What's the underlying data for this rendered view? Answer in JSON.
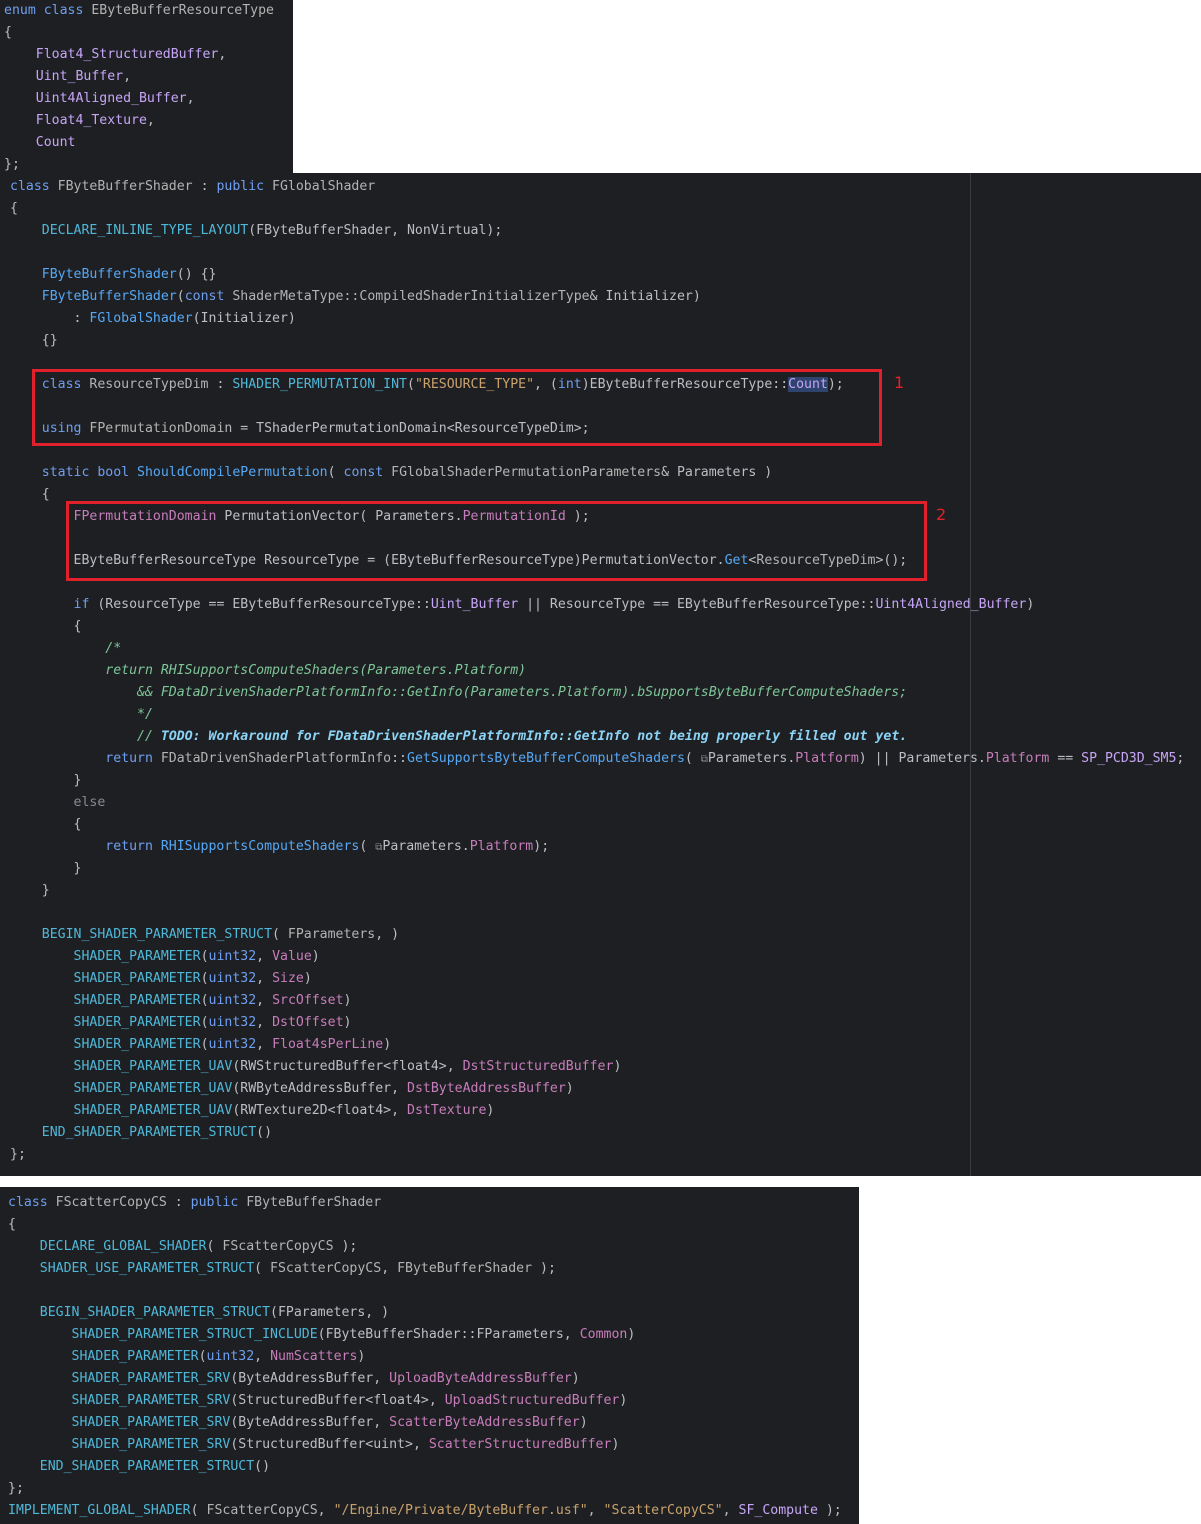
{
  "enum_panel": {
    "lines": [
      [
        [
          "kw",
          "enum class "
        ],
        [
          "type",
          "EByteBufferResourceType"
        ]
      ],
      [
        [
          "plain",
          "{"
        ]
      ],
      [
        [
          "plain",
          "    "
        ],
        [
          "enum",
          "Float4_StructuredBuffer"
        ],
        [
          "plain",
          ","
        ]
      ],
      [
        [
          "plain",
          "    "
        ],
        [
          "enum",
          "Uint_Buffer"
        ],
        [
          "plain",
          ","
        ]
      ],
      [
        [
          "plain",
          "    "
        ],
        [
          "enum",
          "Uint4Aligned_Buffer"
        ],
        [
          "plain",
          ","
        ]
      ],
      [
        [
          "plain",
          "    "
        ],
        [
          "enum",
          "Float4_Texture"
        ],
        [
          "plain",
          ","
        ]
      ],
      [
        [
          "plain",
          "    "
        ],
        [
          "enum",
          "Count"
        ]
      ],
      [
        [
          "plain",
          "};"
        ]
      ]
    ]
  },
  "class_panel": {
    "lines": [
      [
        [
          "kw",
          "class "
        ],
        [
          "type",
          "FByteBufferShader"
        ],
        [
          "plain",
          " : "
        ],
        [
          "kw",
          "public "
        ],
        [
          "type",
          "FGlobalShader"
        ]
      ],
      [
        [
          "plain",
          "{"
        ]
      ],
      [
        [
          "plain",
          "    "
        ],
        [
          "macro",
          "DECLARE_INLINE_TYPE_LAYOUT"
        ],
        [
          "plain",
          "(FByteBufferShader, NonVirtual);"
        ]
      ],
      [
        [
          "plain",
          ""
        ]
      ],
      [
        [
          "plain",
          "    "
        ],
        [
          "fn",
          "FByteBufferShader"
        ],
        [
          "plain",
          "() {}"
        ]
      ],
      [
        [
          "plain",
          "    "
        ],
        [
          "fn",
          "FByteBufferShader"
        ],
        [
          "plain",
          "("
        ],
        [
          "kw",
          "const "
        ],
        [
          "type",
          "ShaderMetaType::CompiledShaderInitializerType"
        ],
        [
          "plain",
          "& Initializer)"
        ]
      ],
      [
        [
          "plain",
          "        : "
        ],
        [
          "fn",
          "FGlobalShader"
        ],
        [
          "plain",
          "(Initializer)"
        ]
      ],
      [
        [
          "plain",
          "    {}"
        ]
      ],
      [
        [
          "plain",
          ""
        ]
      ],
      [
        [
          "plain",
          "    "
        ],
        [
          "kw",
          "class "
        ],
        [
          "type",
          "ResourceTypeDim"
        ],
        [
          "plain",
          " : "
        ],
        [
          "macro",
          "SHADER_PERMUTATION_INT"
        ],
        [
          "plain",
          "("
        ],
        [
          "str",
          "\"RESOURCE_TYPE\""
        ],
        [
          "plain",
          ", ("
        ],
        [
          "kw",
          "int"
        ],
        [
          "plain",
          ")EByteBufferResourceType::"
        ],
        [
          "sel",
          "Count"
        ],
        [
          "plain",
          ");"
        ]
      ],
      [
        [
          "plain",
          ""
        ]
      ],
      [
        [
          "plain",
          "    "
        ],
        [
          "kw",
          "using "
        ],
        [
          "type",
          "FPermutationDomain"
        ],
        [
          "plain",
          " = TShaderPermutationDomain<ResourceTypeDim>;"
        ]
      ],
      [
        [
          "plain",
          ""
        ]
      ],
      [
        [
          "plain",
          "    "
        ],
        [
          "kw",
          "static bool "
        ],
        [
          "fn",
          "ShouldCompilePermutation"
        ],
        [
          "plain",
          "( "
        ],
        [
          "kw",
          "const "
        ],
        [
          "type",
          "FGlobalShaderPermutationParameters"
        ],
        [
          "plain",
          "& Parameters )"
        ]
      ],
      [
        [
          "plain",
          "    {"
        ]
      ],
      [
        [
          "plain",
          "        "
        ],
        [
          "param",
          "FPermutationDomain"
        ],
        [
          "plain",
          " PermutationVector( Parameters."
        ],
        [
          "field",
          "PermutationId"
        ],
        [
          "plain",
          " );"
        ]
      ],
      [
        [
          "plain",
          ""
        ]
      ],
      [
        [
          "plain",
          "        EByteBufferResourceType "
        ],
        [
          "plain",
          "ResourceType"
        ],
        [
          "plain",
          " = (EByteBufferResourceType)PermutationVector."
        ],
        [
          "fn",
          "Get"
        ],
        [
          "plain",
          "<"
        ],
        [
          "type",
          "ResourceTypeDim"
        ],
        [
          "plain",
          ">();"
        ]
      ],
      [
        [
          "plain",
          ""
        ]
      ],
      [
        [
          "plain",
          "        "
        ],
        [
          "kw",
          "if "
        ],
        [
          "plain",
          "(ResourceType == EByteBufferResourceType::"
        ],
        [
          "enum",
          "Uint_Buffer"
        ],
        [
          "plain",
          " || ResourceType == EByteBufferResourceType::"
        ],
        [
          "enum",
          "Uint4Aligned_Buffer"
        ],
        [
          "plain",
          ")"
        ]
      ],
      [
        [
          "plain",
          "        {"
        ]
      ],
      [
        [
          "plain",
          "            "
        ],
        [
          "cm",
          "/*"
        ]
      ],
      [
        [
          "plain",
          "            "
        ],
        [
          "cm",
          "return RHISupportsComputeShaders(Parameters.Platform)"
        ]
      ],
      [
        [
          "plain",
          "                "
        ],
        [
          "cm",
          "&& FDataDrivenShaderPlatformInfo::GetInfo(Parameters.Platform).bSupportsByteBufferComputeShaders;"
        ]
      ],
      [
        [
          "plain",
          "                "
        ],
        [
          "cm",
          "*/"
        ]
      ],
      [
        [
          "plain",
          "                "
        ],
        [
          "cm",
          "// "
        ],
        [
          "todo",
          "TODO: Workaround for FDataDrivenShaderPlatformInfo::GetInfo not being properly filled out yet."
        ]
      ],
      [
        [
          "plain",
          "            "
        ],
        [
          "kw",
          "return "
        ],
        [
          "type",
          "FDataDrivenShaderPlatformInfo"
        ],
        [
          "plain",
          "::"
        ],
        [
          "fn",
          "GetSupportsByteBufferComputeShaders"
        ],
        [
          "plain",
          "( "
        ],
        [
          "hint",
          "⧉"
        ],
        [
          "plain",
          "Parameters."
        ],
        [
          "field",
          "Platform"
        ],
        [
          "plain",
          ") || Parameters."
        ],
        [
          "field",
          "Platform"
        ],
        [
          "plain",
          " == "
        ],
        [
          "enum",
          "SP_PCD3D_SM5"
        ],
        [
          "plain",
          ";"
        ]
      ],
      [
        [
          "plain",
          "        }"
        ]
      ],
      [
        [
          "plain",
          "        "
        ],
        [
          "else",
          "else"
        ]
      ],
      [
        [
          "plain",
          "        {"
        ]
      ],
      [
        [
          "plain",
          "            "
        ],
        [
          "kw",
          "return "
        ],
        [
          "fn",
          "RHISupportsComputeShaders"
        ],
        [
          "plain",
          "( "
        ],
        [
          "hint",
          "⧉"
        ],
        [
          "plain",
          "Parameters."
        ],
        [
          "field",
          "Platform"
        ],
        [
          "plain",
          ");"
        ]
      ],
      [
        [
          "plain",
          "        }"
        ]
      ],
      [
        [
          "plain",
          "    }"
        ]
      ],
      [
        [
          "plain",
          ""
        ]
      ],
      [
        [
          "plain",
          "    "
        ],
        [
          "macro",
          "BEGIN_SHADER_PARAMETER_STRUCT"
        ],
        [
          "plain",
          "( "
        ],
        [
          "type",
          "FParameters"
        ],
        [
          "plain",
          ", )"
        ]
      ],
      [
        [
          "plain",
          "        "
        ],
        [
          "macro",
          "SHADER_PARAMETER"
        ],
        [
          "plain",
          "("
        ],
        [
          "kw",
          "uint32"
        ],
        [
          "plain",
          ", "
        ],
        [
          "field",
          "Value"
        ],
        [
          "plain",
          ")"
        ]
      ],
      [
        [
          "plain",
          "        "
        ],
        [
          "macro",
          "SHADER_PARAMETER"
        ],
        [
          "plain",
          "("
        ],
        [
          "kw",
          "uint32"
        ],
        [
          "plain",
          ", "
        ],
        [
          "field",
          "Size"
        ],
        [
          "plain",
          ")"
        ]
      ],
      [
        [
          "plain",
          "        "
        ],
        [
          "macro",
          "SHADER_PARAMETER"
        ],
        [
          "plain",
          "("
        ],
        [
          "kw",
          "uint32"
        ],
        [
          "plain",
          ", "
        ],
        [
          "field",
          "SrcOffset"
        ],
        [
          "plain",
          ")"
        ]
      ],
      [
        [
          "plain",
          "        "
        ],
        [
          "macro",
          "SHADER_PARAMETER"
        ],
        [
          "plain",
          "("
        ],
        [
          "kw",
          "uint32"
        ],
        [
          "plain",
          ", "
        ],
        [
          "field",
          "DstOffset"
        ],
        [
          "plain",
          ")"
        ]
      ],
      [
        [
          "plain",
          "        "
        ],
        [
          "macro",
          "SHADER_PARAMETER"
        ],
        [
          "plain",
          "("
        ],
        [
          "kw",
          "uint32"
        ],
        [
          "plain",
          ", "
        ],
        [
          "field",
          "Float4sPerLine"
        ],
        [
          "plain",
          ")"
        ]
      ],
      [
        [
          "plain",
          "        "
        ],
        [
          "macro",
          "SHADER_PARAMETER_UAV"
        ],
        [
          "plain",
          "(RWStructuredBuffer<float4>, "
        ],
        [
          "field",
          "DstStructuredBuffer"
        ],
        [
          "plain",
          ")"
        ]
      ],
      [
        [
          "plain",
          "        "
        ],
        [
          "macro",
          "SHADER_PARAMETER_UAV"
        ],
        [
          "plain",
          "(RWByteAddressBuffer, "
        ],
        [
          "field",
          "DstByteAddressBuffer"
        ],
        [
          "plain",
          ")"
        ]
      ],
      [
        [
          "plain",
          "        "
        ],
        [
          "macro",
          "SHADER_PARAMETER_UAV"
        ],
        [
          "plain",
          "(RWTexture2D<float4>, "
        ],
        [
          "field",
          "DstTexture"
        ],
        [
          "plain",
          ")"
        ]
      ],
      [
        [
          "plain",
          "    "
        ],
        [
          "macro",
          "END_SHADER_PARAMETER_STRUCT"
        ],
        [
          "plain",
          "()"
        ]
      ],
      [
        [
          "plain",
          "};"
        ]
      ]
    ],
    "annotations": [
      {
        "label": "1"
      },
      {
        "label": "2"
      }
    ]
  },
  "scatter_panel": {
    "lines": [
      [
        [
          "kw",
          "class "
        ],
        [
          "type",
          "FScatterCopyCS"
        ],
        [
          "plain",
          " : "
        ],
        [
          "kw",
          "public "
        ],
        [
          "type",
          "FByteBufferShader"
        ]
      ],
      [
        [
          "plain",
          "{"
        ]
      ],
      [
        [
          "plain",
          "    "
        ],
        [
          "macro",
          "DECLARE_GLOBAL_SHADER"
        ],
        [
          "plain",
          "( "
        ],
        [
          "type",
          "FScatterCopyCS"
        ],
        [
          "plain",
          " );"
        ]
      ],
      [
        [
          "plain",
          "    "
        ],
        [
          "macro",
          "SHADER_USE_PARAMETER_STRUCT"
        ],
        [
          "plain",
          "( "
        ],
        [
          "type",
          "FScatterCopyCS"
        ],
        [
          "plain",
          ", "
        ],
        [
          "type",
          "FByteBufferShader"
        ],
        [
          "plain",
          " );"
        ]
      ],
      [
        [
          "plain",
          ""
        ]
      ],
      [
        [
          "plain",
          "    "
        ],
        [
          "macro",
          "BEGIN_SHADER_PARAMETER_STRUCT"
        ],
        [
          "plain",
          "(FParameters, )"
        ]
      ],
      [
        [
          "plain",
          "        "
        ],
        [
          "macro",
          "SHADER_PARAMETER_STRUCT_INCLUDE"
        ],
        [
          "plain",
          "(FByteBufferShader::FParameters, "
        ],
        [
          "field",
          "Common"
        ],
        [
          "plain",
          ")"
        ]
      ],
      [
        [
          "plain",
          "        "
        ],
        [
          "macro",
          "SHADER_PARAMETER"
        ],
        [
          "plain",
          "("
        ],
        [
          "kw",
          "uint32"
        ],
        [
          "plain",
          ", "
        ],
        [
          "field",
          "NumScatters"
        ],
        [
          "plain",
          ")"
        ]
      ],
      [
        [
          "plain",
          "        "
        ],
        [
          "macro",
          "SHADER_PARAMETER_SRV"
        ],
        [
          "plain",
          "(ByteAddressBuffer, "
        ],
        [
          "field",
          "UploadByteAddressBuffer"
        ],
        [
          "plain",
          ")"
        ]
      ],
      [
        [
          "plain",
          "        "
        ],
        [
          "macro",
          "SHADER_PARAMETER_SRV"
        ],
        [
          "plain",
          "(StructuredBuffer<float4>, "
        ],
        [
          "field",
          "UploadStructuredBuffer"
        ],
        [
          "plain",
          ")"
        ]
      ],
      [
        [
          "plain",
          "        "
        ],
        [
          "macro",
          "SHADER_PARAMETER_SRV"
        ],
        [
          "plain",
          "(ByteAddressBuffer, "
        ],
        [
          "field",
          "ScatterByteAddressBuffer"
        ],
        [
          "plain",
          ")"
        ]
      ],
      [
        [
          "plain",
          "        "
        ],
        [
          "macro",
          "SHADER_PARAMETER_SRV"
        ],
        [
          "plain",
          "(StructuredBuffer<uint>, "
        ],
        [
          "field",
          "ScatterStructuredBuffer"
        ],
        [
          "plain",
          ")"
        ]
      ],
      [
        [
          "plain",
          "    "
        ],
        [
          "macro",
          "END_SHADER_PARAMETER_STRUCT"
        ],
        [
          "plain",
          "()"
        ]
      ],
      [
        [
          "plain",
          "};"
        ]
      ],
      [
        [
          "macro",
          "IMPLEMENT_GLOBAL_SHADER"
        ],
        [
          "plain",
          "( "
        ],
        [
          "type",
          "FScatterCopyCS"
        ],
        [
          "plain",
          ", "
        ],
        [
          "str",
          "\"/Engine/Private/ByteBuffer.usf\""
        ],
        [
          "plain",
          ", "
        ],
        [
          "str",
          "\"ScatterCopyCS\""
        ],
        [
          "plain",
          ", "
        ],
        [
          "enum",
          "SF_Compute"
        ],
        [
          "plain",
          " );"
        ]
      ]
    ]
  }
}
